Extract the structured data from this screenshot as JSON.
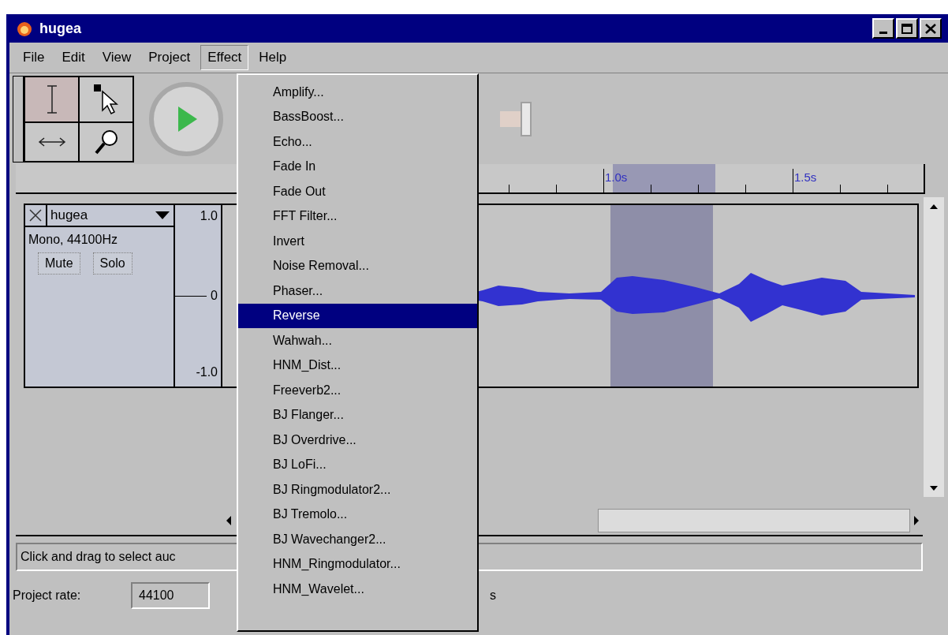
{
  "window": {
    "title": "hugea"
  },
  "menu_bar": [
    {
      "label": "File",
      "selected": false
    },
    {
      "label": "Edit",
      "selected": false
    },
    {
      "label": "View",
      "selected": false
    },
    {
      "label": "Project",
      "selected": false
    },
    {
      "label": "Effect",
      "selected": true
    },
    {
      "label": "Help",
      "selected": false
    }
  ],
  "volume_slider": {
    "level": 0.8
  },
  "tools": [
    {
      "kind": "select",
      "selected": true
    },
    {
      "kind": "envelope",
      "selected": false
    },
    {
      "kind": "timeshift",
      "selected": false
    },
    {
      "kind": "zoom",
      "selected": false
    }
  ],
  "effect_menu": {
    "items": [
      {
        "label": "Amplify...",
        "selected": false
      },
      {
        "label": "BassBoost...",
        "selected": false
      },
      {
        "label": "Echo...",
        "selected": false
      },
      {
        "label": "Fade In",
        "selected": false
      },
      {
        "label": "Fade Out",
        "selected": false
      },
      {
        "label": "FFT Filter...",
        "selected": false
      },
      {
        "label": "Invert",
        "selected": false
      },
      {
        "label": "Noise Removal...",
        "selected": false
      },
      {
        "label": "Phaser...",
        "selected": false
      },
      {
        "label": "Reverse",
        "selected": true
      },
      {
        "label": "Wahwah...",
        "selected": false
      },
      {
        "label": "HNM_Dist...",
        "selected": false
      },
      {
        "label": "Freeverb2...",
        "selected": false
      },
      {
        "label": "BJ Flanger...",
        "selected": false
      },
      {
        "label": "BJ Overdrive...",
        "selected": false
      },
      {
        "label": "BJ LoFi...",
        "selected": false
      },
      {
        "label": "BJ Ringmodulator2...",
        "selected": false
      },
      {
        "label": "BJ Tremolo...",
        "selected": false
      },
      {
        "label": "BJ Wavechanger2...",
        "selected": false
      },
      {
        "label": "HNM_Ringmodulator...",
        "selected": false
      },
      {
        "label": "HNM_Wavelet...",
        "selected": false
      }
    ]
  },
  "ruler": {
    "labels": [
      "1.0s",
      "1.5s"
    ]
  },
  "track": {
    "name": "hugea",
    "info": "Mono, 44100Hz",
    "buttons": [
      "Mute",
      "Solo"
    ],
    "scale": [
      "1.0",
      "0",
      "-1.0"
    ]
  },
  "status_bar": {
    "message": "Click and drag to select auc",
    "project_rate_label": "Project rate:",
    "project_rate": "44100",
    "right_text": "s"
  }
}
